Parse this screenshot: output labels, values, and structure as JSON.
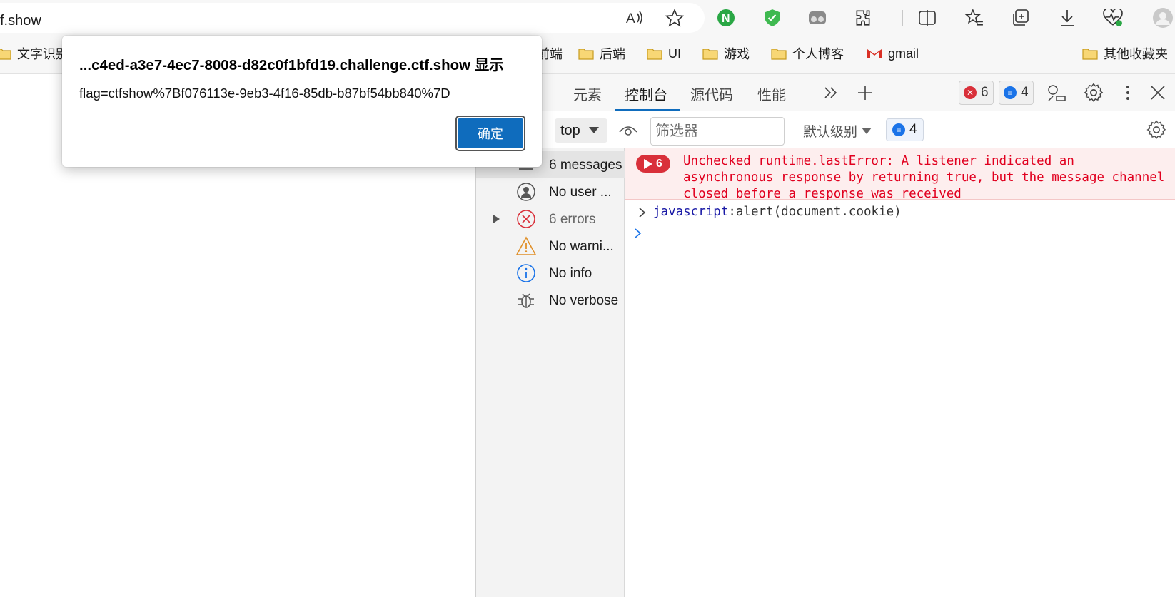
{
  "browser": {
    "url": "f.show",
    "toolbar_icons": [
      "read-aloud-icon",
      "favorite-star-icon",
      "extension-n-icon",
      "shield-extension-icon",
      "tracking-icon",
      "extensions-puzzle-icon",
      "split-screen-icon",
      "favorites-icon",
      "collections-icon",
      "downloads-icon",
      "browser-essentials-icon",
      "profile-avatar-icon"
    ]
  },
  "bookmarks": {
    "items": [
      "文字识别",
      "前端",
      "后端",
      "UI",
      "游戏",
      "个人博客",
      "gmail"
    ],
    "other": "其他收藏夹"
  },
  "devtools": {
    "tabs": [
      "元素",
      "控制台",
      "源代码",
      "性能"
    ],
    "active_tab": "控制台",
    "error_count": "6",
    "message_count": "4",
    "context": "top",
    "filter_placeholder": "筛选器",
    "level": "默认级别",
    "level_count": "4",
    "sidebar": [
      {
        "label": "6 messages"
      },
      {
        "label": "No user ..."
      },
      {
        "label": "6 errors"
      },
      {
        "label": "No warni..."
      },
      {
        "label": "No info"
      },
      {
        "label": "No verbose"
      }
    ],
    "console": {
      "error_badge": "6",
      "error_message": "Unchecked runtime.lastError: A listener indicated an asynchronous response by returning true, but the message channel closed before a response was received",
      "command_keyword": "javascript",
      "command_rest": ":alert(document.cookie)"
    }
  },
  "dialog": {
    "title": "...c4ed-a3e7-4ec7-8008-d82c0f1bfd19.challenge.ctf.show 显示",
    "message": "flag=ctfshow%7Bf076113e-9eb3-4f16-85db-b87bf54bb840%7D",
    "ok_label": "确定"
  },
  "colors": {
    "accent": "#0f6cbd",
    "error": "#e1001f",
    "error_bg": "#fdeeee"
  }
}
